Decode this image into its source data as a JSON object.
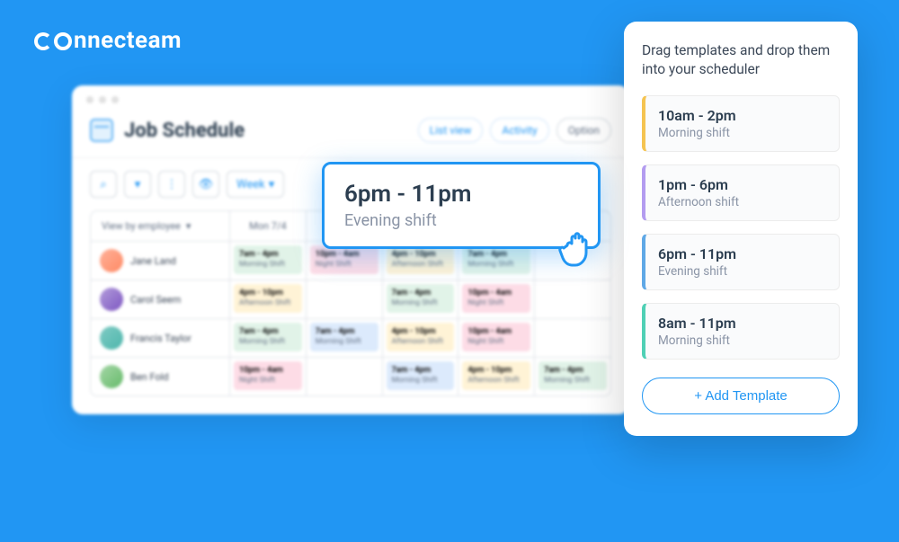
{
  "brand": "nnecteam",
  "scheduler": {
    "title": "Job Schedule",
    "actions": {
      "list_view": "List view",
      "activity": "Activity",
      "options": "Option"
    },
    "toolbar": {
      "week": "Week"
    },
    "view_by": "View by employee",
    "day_header": "Mon 7/4",
    "employees": [
      {
        "name": "Jane Land",
        "shifts": [
          {
            "time": "7am - 4pm",
            "label": "Morning Shift",
            "color": "green"
          },
          {
            "time": "10pm - 4am",
            "label": "Night Shift",
            "color": "pink"
          },
          {
            "time": "4pm - 10pm",
            "label": "Afternoon Shift",
            "color": "yellow"
          },
          {
            "time": "7am - 4pm",
            "label": "Morning Shift",
            "color": "green"
          }
        ]
      },
      {
        "name": "Carol Seem",
        "shifts": [
          {
            "time": "4pm - 10pm",
            "label": "Afternoon Shift",
            "color": "yellow"
          },
          {
            "time": "",
            "label": "",
            "color": ""
          },
          {
            "time": "7am - 4pm",
            "label": "Morning Shift",
            "color": "green"
          },
          {
            "time": "10pm - 4am",
            "label": "Night Shift",
            "color": "pink"
          }
        ]
      },
      {
        "name": "Francis Taylor",
        "shifts": [
          {
            "time": "7am - 4pm",
            "label": "Morning Shift",
            "color": "green"
          },
          {
            "time": "7am - 4pm",
            "label": "Morning Shift",
            "color": "blue"
          },
          {
            "time": "4pm - 10pm",
            "label": "Afternoon Shift",
            "color": "yellow"
          },
          {
            "time": "10pm - 4am",
            "label": "Night Shift",
            "color": "pink"
          }
        ]
      },
      {
        "name": "Ben Fold",
        "shifts": [
          {
            "time": "10pm - 4am",
            "label": "Night Shift",
            "color": "pink"
          },
          {
            "time": "",
            "label": "",
            "color": ""
          },
          {
            "time": "7am - 4pm",
            "label": "Morning Shift",
            "color": "blue"
          },
          {
            "time": "4pm - 10pm",
            "label": "Afternoon Shift",
            "color": "yellow"
          },
          {
            "time": "7am - 4pm",
            "label": "Morning Shift",
            "color": "green"
          }
        ]
      }
    ]
  },
  "dragged": {
    "time": "6pm - 11pm",
    "label": "Evening shift"
  },
  "templates": {
    "title": "Drag templates and drop them into your scheduler",
    "items": [
      {
        "time": "10am - 2pm",
        "label": "Morning shift"
      },
      {
        "time": "1pm - 6pm",
        "label": "Afternoon shift"
      },
      {
        "time": "6pm - 11pm",
        "label": "Evening shift"
      },
      {
        "time": "8am - 11pm",
        "label": "Morning shift"
      }
    ],
    "add_label": "+ Add Template"
  }
}
